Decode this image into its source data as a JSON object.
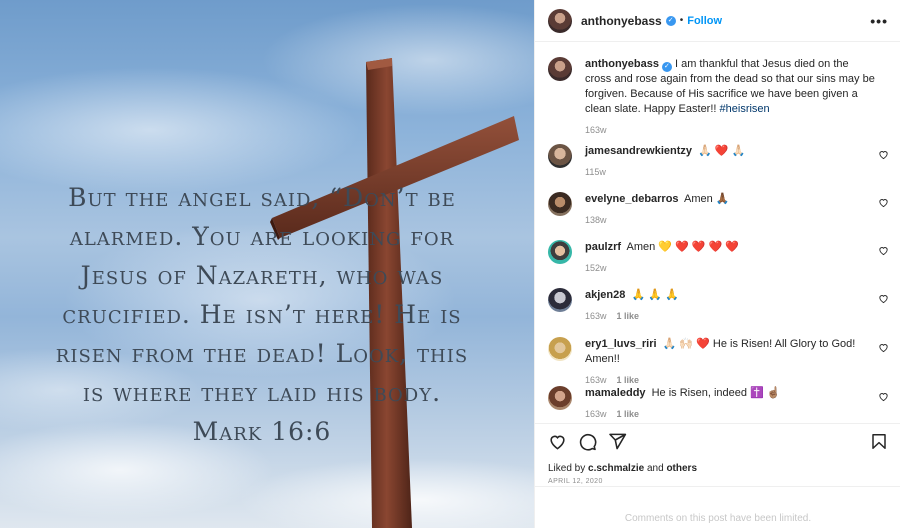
{
  "post": {
    "username": "anthonyebass",
    "verified_icon": "verified-badge-icon",
    "follow_label": "Follow",
    "more_icon": "more-options-icon",
    "more_label": "•••"
  },
  "media": {
    "verse_lines": [
      "But the angel said, “Don’t be",
      "alarmed. You are looking for",
      "Jesus of Nazareth, who was",
      "crucified. He isn’t here! He is",
      "risen from the dead! Look, this",
      "is where they laid his body.",
      "Mark 16:6"
    ],
    "cross_color": "#7a3a26"
  },
  "caption": {
    "username": "anthonyebass",
    "text": "I am thankful that Jesus died on the cross and rose again from the dead so that our sins may be forgiven. Because of His sacrifice we have been given a clean slate. Happy Easter!!",
    "hashtag": "#heisrisen",
    "age": "163w"
  },
  "comments": [
    {
      "username": "jamesandrewkientzy",
      "text": "🙏🏻 ❤️ 🙏🏻",
      "age": "115w",
      "likes": ""
    },
    {
      "username": "evelyne_debarros",
      "text": "Amen 🙏🏾",
      "age": "138w",
      "likes": ""
    },
    {
      "username": "paulzrf",
      "text": "Amen 💛 ❤️ ❤️ ❤️ ❤️",
      "age": "152w",
      "likes": ""
    },
    {
      "username": "akjen28",
      "text": "🙏 🙏 🙏",
      "age": "163w",
      "likes": "1 like"
    },
    {
      "username": "ery1_luvs_riri",
      "text": "🙏🏻 🙌🏻 ❤️  He is Risen! All Glory to God! Amen!!",
      "age": "163w",
      "likes": "1 like"
    },
    {
      "username": "mamaleddy",
      "text": "He is Risen, indeed ✝️ ☝🏽",
      "age": "163w",
      "likes": "1 like"
    }
  ],
  "actions": {
    "icons": [
      "like-icon",
      "comment-icon",
      "share-icon",
      "save-icon"
    ],
    "liked_prefix": "Liked by",
    "liked_user": "c.schmalzie",
    "liked_and": "and",
    "liked_others": "others",
    "date": "APRIL 12, 2020",
    "comments_limited": "Comments on this post have been limited."
  }
}
